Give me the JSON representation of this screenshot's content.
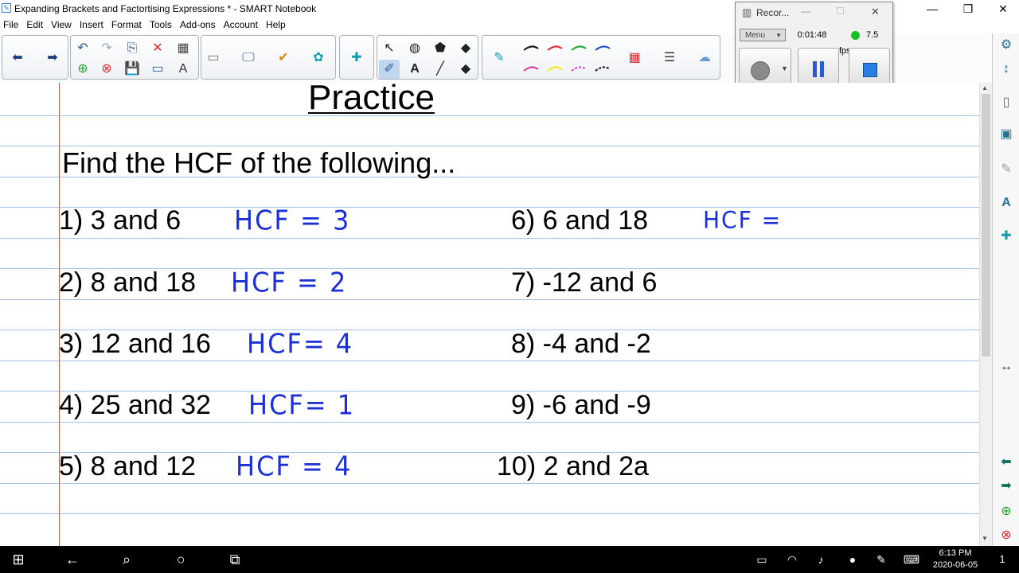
{
  "window": {
    "title": "Expanding Brackets and Factortising Expressions * - SMART Notebook",
    "minimize": "—",
    "maximize": "❐",
    "close": "✕"
  },
  "menu": [
    "File",
    "Edit",
    "View",
    "Insert",
    "Format",
    "Tools",
    "Add-ons",
    "Account",
    "Help"
  ],
  "recorder": {
    "title": "Recor...",
    "menu_label": "Menu",
    "elapsed": "0:01:48",
    "fps": "7.5 fps",
    "close": "✕"
  },
  "page": {
    "heading": "Practice",
    "instruction": "Find the HCF of the following...",
    "questions_left": [
      "1) 3 and 6",
      "2) 8 and 18",
      "3) 12 and 16",
      "4) 25 and 32",
      "5) 8 and 12"
    ],
    "questions_right": [
      "6) 6 and 18",
      "7) -12 and 6",
      "8) -4 and -2",
      "9) -6 and -9",
      "10) 2 and 2a"
    ],
    "answers": [
      "HCF = 3",
      "HCF = 2",
      "HCF= 4",
      "HCF= 1",
      "HCF = 4",
      "HCF ="
    ]
  },
  "colors": {
    "ink": "#1b2fd6",
    "ruled_line": "#a7c4e2",
    "margin_line": "#d9534f",
    "pen_colors": [
      "#111111",
      "#e0282e",
      "#1fa82c",
      "#1f4fd1",
      "#e0399c",
      "#f5e614",
      "#d63fd1",
      "#111111"
    ]
  },
  "taskbar": {
    "time": "6:13 PM",
    "date": "2020-06-05",
    "notifications": "1"
  }
}
